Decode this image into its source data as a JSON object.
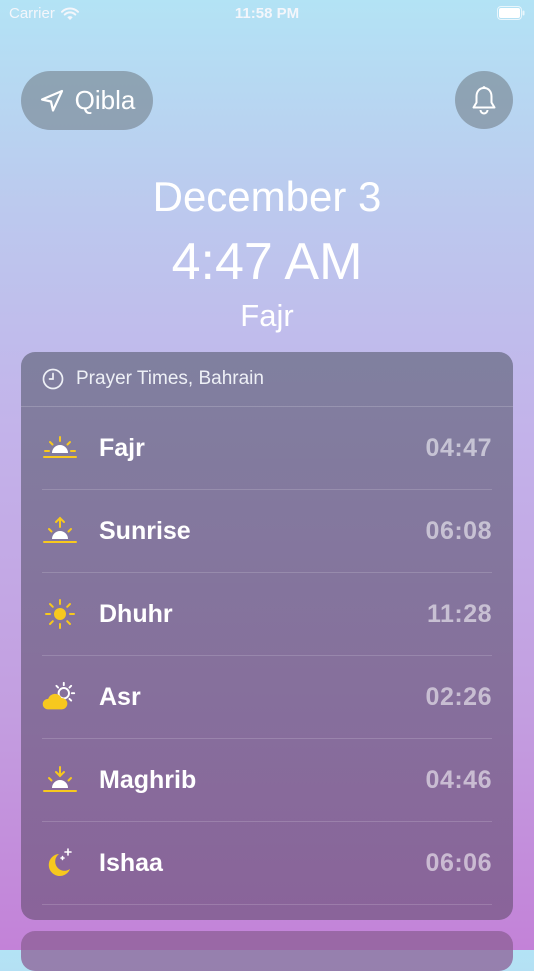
{
  "status_bar": {
    "carrier": "Carrier",
    "time": "11:58 PM"
  },
  "header": {
    "qibla_label": "Qibla"
  },
  "hero": {
    "date": "December 3",
    "time": "4:47 AM",
    "current_prayer": "Fajr"
  },
  "card": {
    "title": "Prayer Times, Bahrain",
    "prayers": [
      {
        "name": "Fajr",
        "time": "04:47",
        "icon": "sunrise-low-icon"
      },
      {
        "name": "Sunrise",
        "time": "06:08",
        "icon": "sunrise-icon"
      },
      {
        "name": "Dhuhr",
        "time": "11:28",
        "icon": "sun-icon"
      },
      {
        "name": "Asr",
        "time": "02:26",
        "icon": "cloud-sun-icon"
      },
      {
        "name": "Maghrib",
        "time": "04:46",
        "icon": "sunset-icon"
      },
      {
        "name": "Ishaa",
        "time": "06:06",
        "icon": "moon-stars-icon"
      }
    ]
  },
  "colors": {
    "icon_yellow": "#f7c81e",
    "time_gray": "#b9b2c6"
  }
}
